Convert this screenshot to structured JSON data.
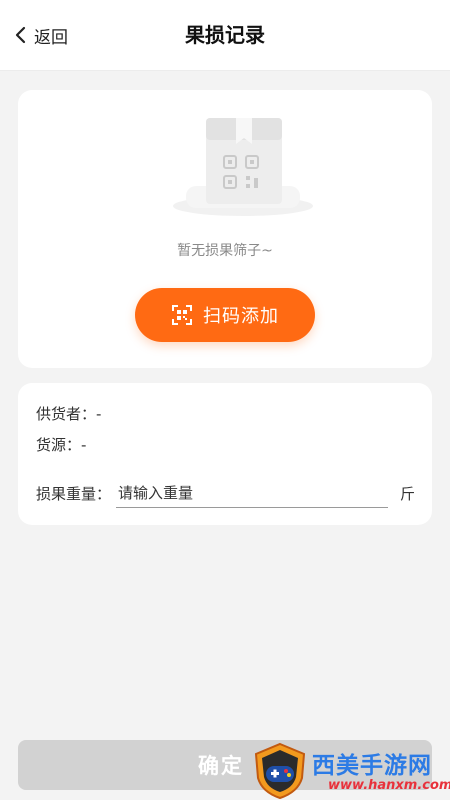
{
  "header": {
    "back_label": "返回",
    "title": "果损记录"
  },
  "empty_state": {
    "message": "暂无损果筛子~",
    "scan_button_label": "扫码添加",
    "icon": "qr-box-illustration"
  },
  "info": {
    "supplier_label": "供货者：-",
    "source_label": "货源：-",
    "weight_label": "损果重量：",
    "weight_placeholder": "请输入重量",
    "weight_value": "",
    "weight_unit": "斤"
  },
  "footer": {
    "confirm_label": "确定"
  },
  "watermark": {
    "title": "西美手游网",
    "url": "www.hanxm.com"
  },
  "colors": {
    "accent": "#ff6a13",
    "confirm_disabled": "#d2d2d2",
    "watermark_blue": "#2c7be5",
    "watermark_red": "#e8313b"
  }
}
